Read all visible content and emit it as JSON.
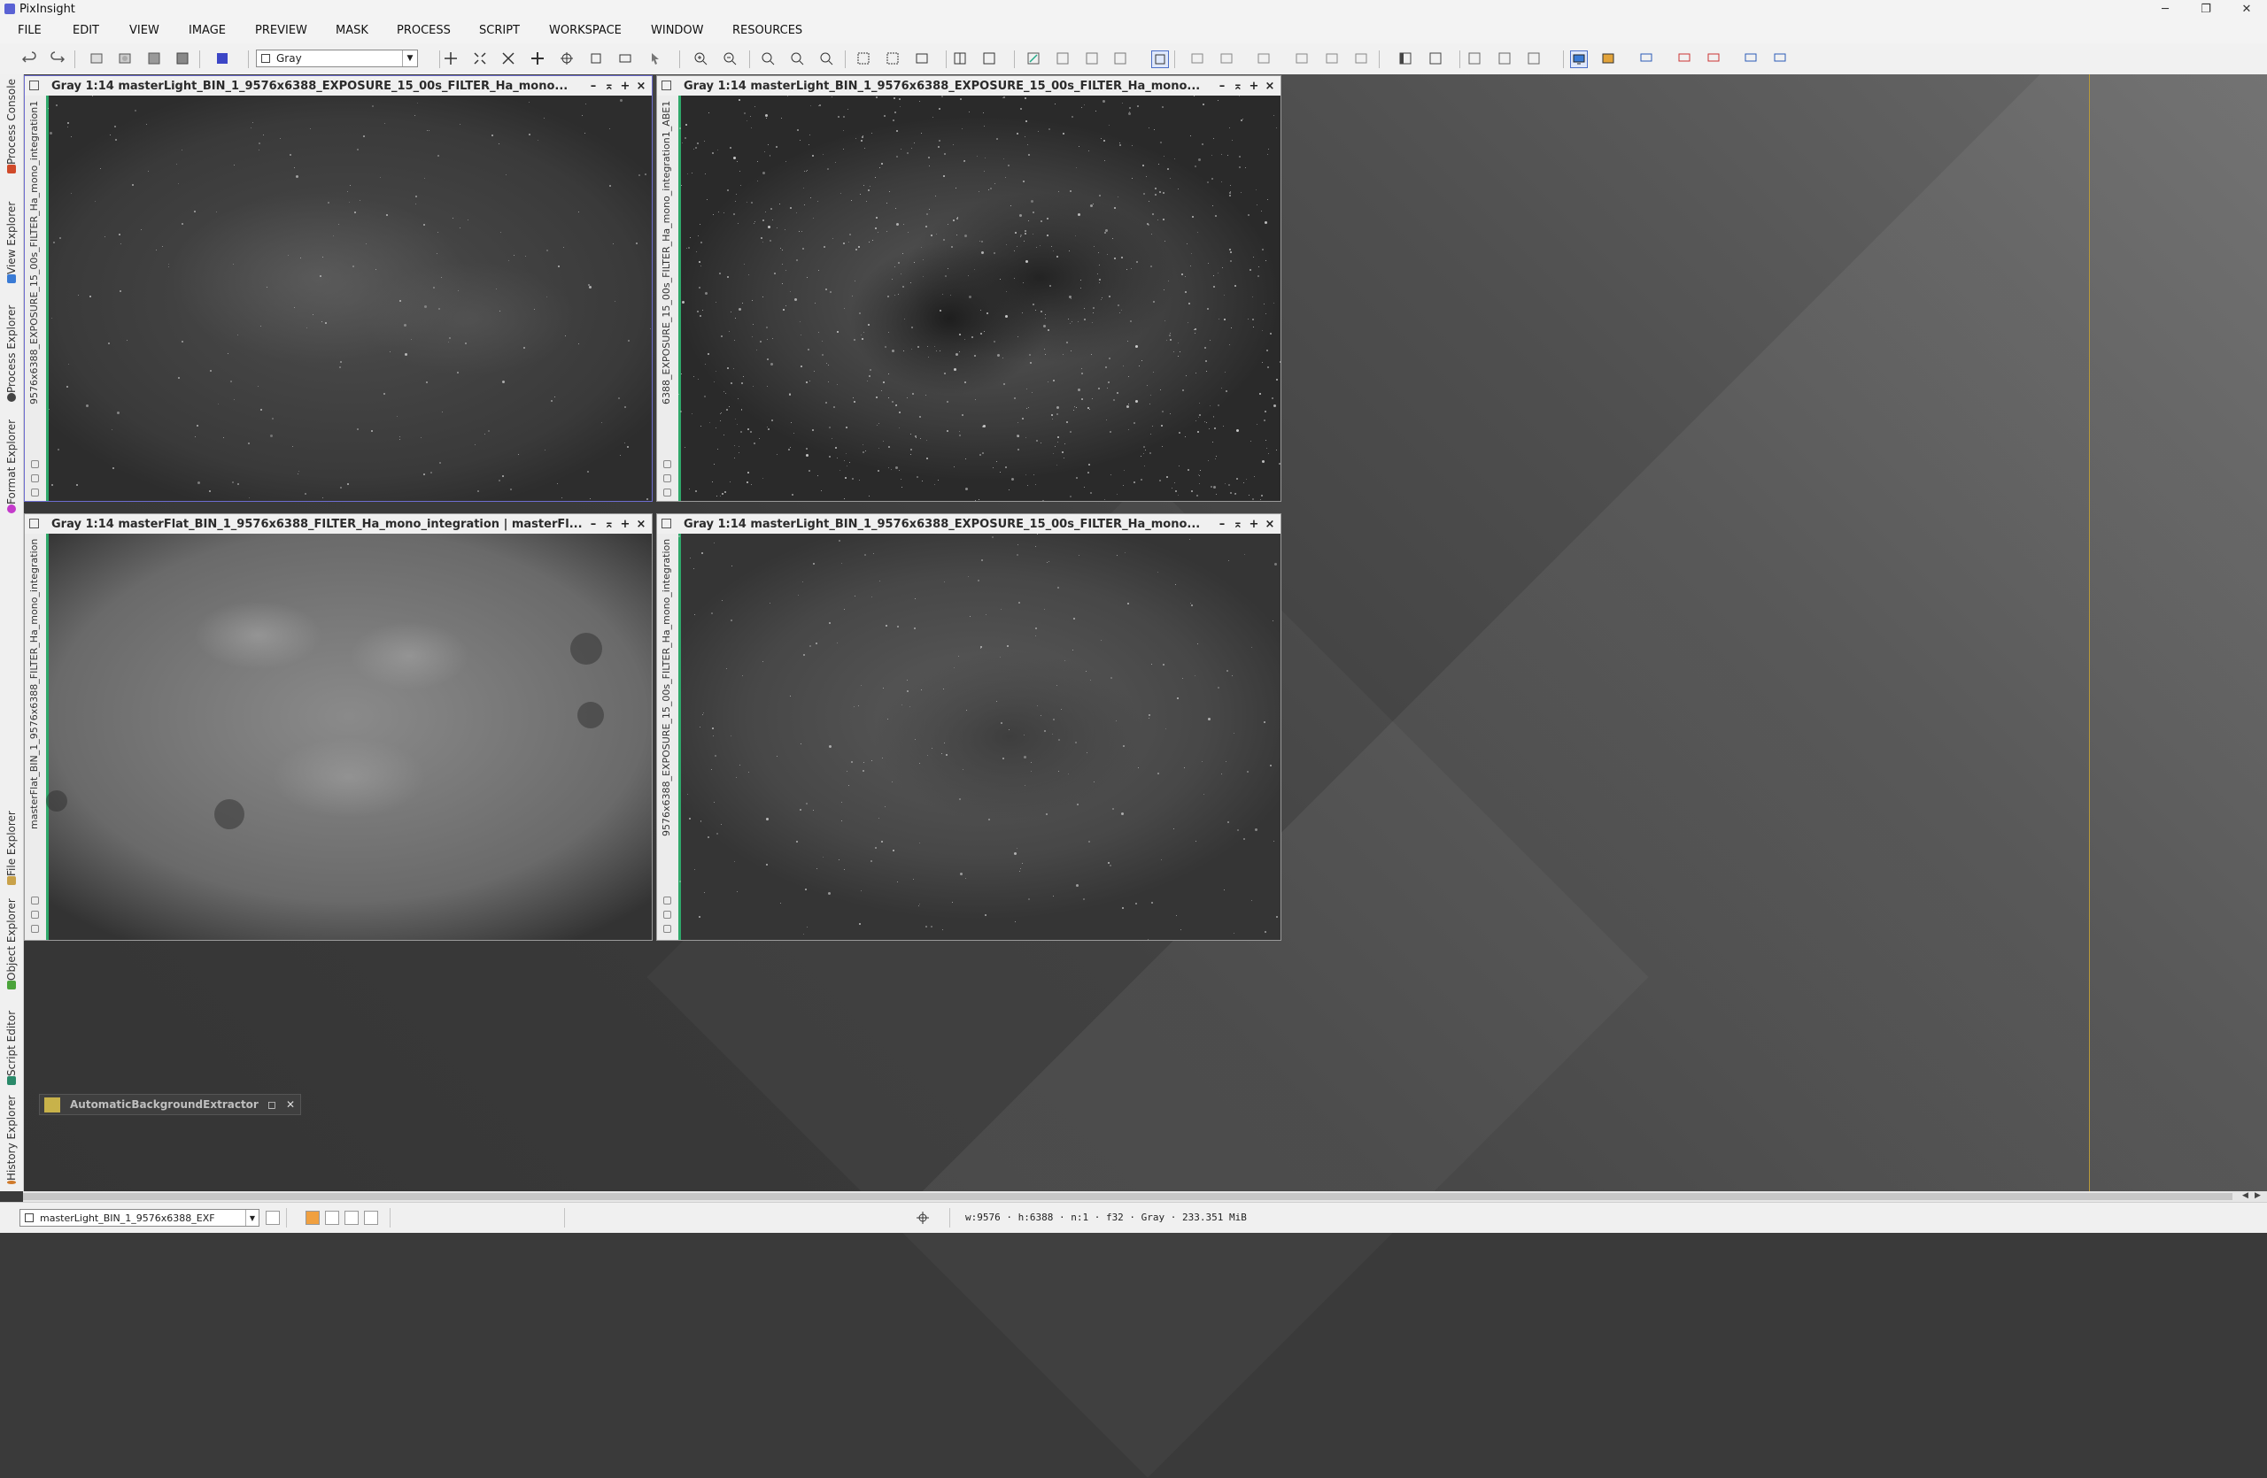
{
  "app": {
    "title": "PixInsight"
  },
  "window_controls": {
    "minimize": "─",
    "restore": "❐",
    "close": "✕"
  },
  "menu": [
    "FILE",
    "EDIT",
    "VIEW",
    "IMAGE",
    "PREVIEW",
    "MASK",
    "PROCESS",
    "SCRIPT",
    "WORKSPACE",
    "WINDOW",
    "RESOURCES"
  ],
  "toolbar": {
    "display_mode": "Gray"
  },
  "left_dock": {
    "top_tabs": [
      "Process Console",
      "View Explorer",
      "Process Explorer",
      "Format Explorer"
    ],
    "bottom_tabs": [
      "File Explorer",
      "Object Explorer",
      "Script Editor",
      "History Explorer"
    ]
  },
  "image_windows": [
    {
      "title": "Gray 1:14 masterLight_BIN_1_9576x6388_EXPOSURE_15_00s_FILTER_Ha_mono...",
      "view_id": "9576x6388_EXPOSURE_15_00s_FILTER_Ha_mono_integration1",
      "active": true
    },
    {
      "title": "Gray 1:14 masterLight_BIN_1_9576x6388_EXPOSURE_15_00s_FILTER_Ha_mono...",
      "view_id": "6388_EXPOSURE_15_00s_FILTER_Ha_mono_integration1_ABE1",
      "active": false
    },
    {
      "title": "Gray 1:14 masterFlat_BIN_1_9576x6388_FILTER_Ha_mono_integration | masterFl...",
      "view_id": "masterFlat_BIN_1_9576x6388_FILTER_Ha_mono_integration",
      "active": false
    },
    {
      "title": "Gray 1:14 masterLight_BIN_1_9576x6388_EXPOSURE_15_00s_FILTER_Ha_mono...",
      "view_id": "9576x6388_EXPOSURE_15_00s_FILTER_Ha_mono_integration",
      "active": false
    }
  ],
  "process_icon": {
    "label": "AutomaticBackgroundExtractor"
  },
  "statusbar": {
    "view_selector": "masterLight_BIN_1_9576x6388_EXF",
    "info": "w:9576 · h:6388 · n:1 · f32 · Gray · 233.351 MiB"
  },
  "colors": {
    "accent_active_border": "#6d6dd0",
    "workspace_guide": "#b99a3b",
    "view_edge": "#2fa86a"
  }
}
